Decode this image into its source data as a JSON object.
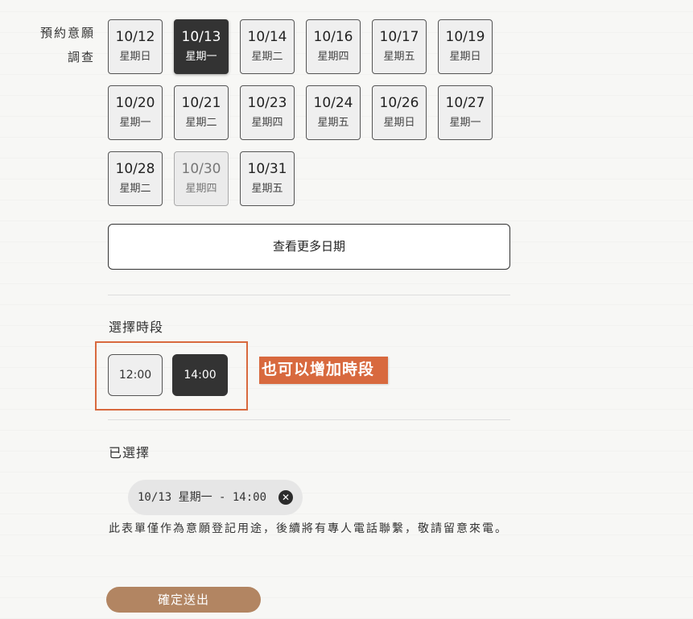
{
  "form": {
    "label_line1": "預約意願",
    "label_line2": "調查",
    "more_dates_label": "查看更多日期",
    "time_section_title": "選擇時段",
    "selected_section_title": "已選擇",
    "note": "此表單僅作為意願登記用途，後續將有專人電話聯繫，敬請留意來電。",
    "submit_label": "確定送出"
  },
  "dates": [
    {
      "date": "10/12",
      "weekday": "星期日",
      "state": "normal"
    },
    {
      "date": "10/13",
      "weekday": "星期一",
      "state": "selected"
    },
    {
      "date": "10/14",
      "weekday": "星期二",
      "state": "normal"
    },
    {
      "date": "10/16",
      "weekday": "星期四",
      "state": "normal"
    },
    {
      "date": "10/17",
      "weekday": "星期五",
      "state": "normal"
    },
    {
      "date": "10/19",
      "weekday": "星期日",
      "state": "normal"
    },
    {
      "date": "10/20",
      "weekday": "星期一",
      "state": "normal"
    },
    {
      "date": "10/21",
      "weekday": "星期二",
      "state": "normal"
    },
    {
      "date": "10/23",
      "weekday": "星期四",
      "state": "normal"
    },
    {
      "date": "10/24",
      "weekday": "星期五",
      "state": "normal"
    },
    {
      "date": "10/26",
      "weekday": "星期日",
      "state": "normal"
    },
    {
      "date": "10/27",
      "weekday": "星期一",
      "state": "normal"
    },
    {
      "date": "10/28",
      "weekday": "星期二",
      "state": "normal"
    },
    {
      "date": "10/30",
      "weekday": "星期四",
      "state": "dim"
    },
    {
      "date": "10/31",
      "weekday": "星期五",
      "state": "normal"
    }
  ],
  "times": [
    {
      "label": "12:00",
      "selected": false
    },
    {
      "label": "14:00",
      "selected": true
    }
  ],
  "annotation": {
    "text": "也可以增加時段",
    "color": "#d8693e"
  },
  "selected_chip": {
    "text": "10/13 星期一 - 14:00",
    "close_icon": "close-circle-icon"
  },
  "colors": {
    "selected_bg": "#333333",
    "submit_bg": "#b28562",
    "highlight_border": "#d8693e"
  }
}
